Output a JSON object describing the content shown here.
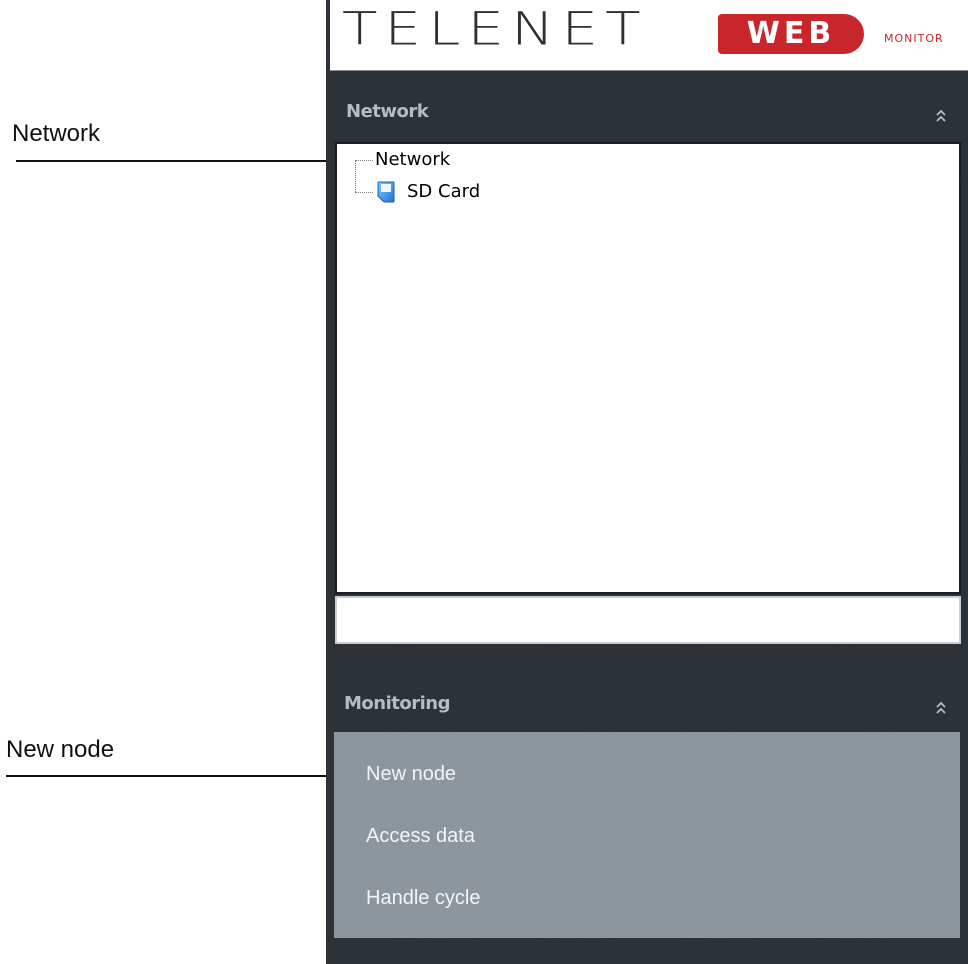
{
  "callouts": {
    "network_label": "Network",
    "new_node_label": "New node"
  },
  "logo": {
    "brand": "TELENET",
    "badge": "WEB",
    "tagline": "MONITOR"
  },
  "network_panel": {
    "title": "Network",
    "tree": {
      "root": "Network",
      "children": [
        {
          "label": "SD Card",
          "icon": "sd-card-icon"
        }
      ]
    },
    "text_field_value": ""
  },
  "monitoring_panel": {
    "title": "Monitoring",
    "items": [
      {
        "label": "New node"
      },
      {
        "label": "Access data"
      },
      {
        "label": "Handle cycle"
      }
    ]
  },
  "colors": {
    "panel_bg": "#2b3137",
    "header_text": "#b7bcc1",
    "menu_bg": "#8e969d",
    "brand_red": "#c9262c"
  }
}
